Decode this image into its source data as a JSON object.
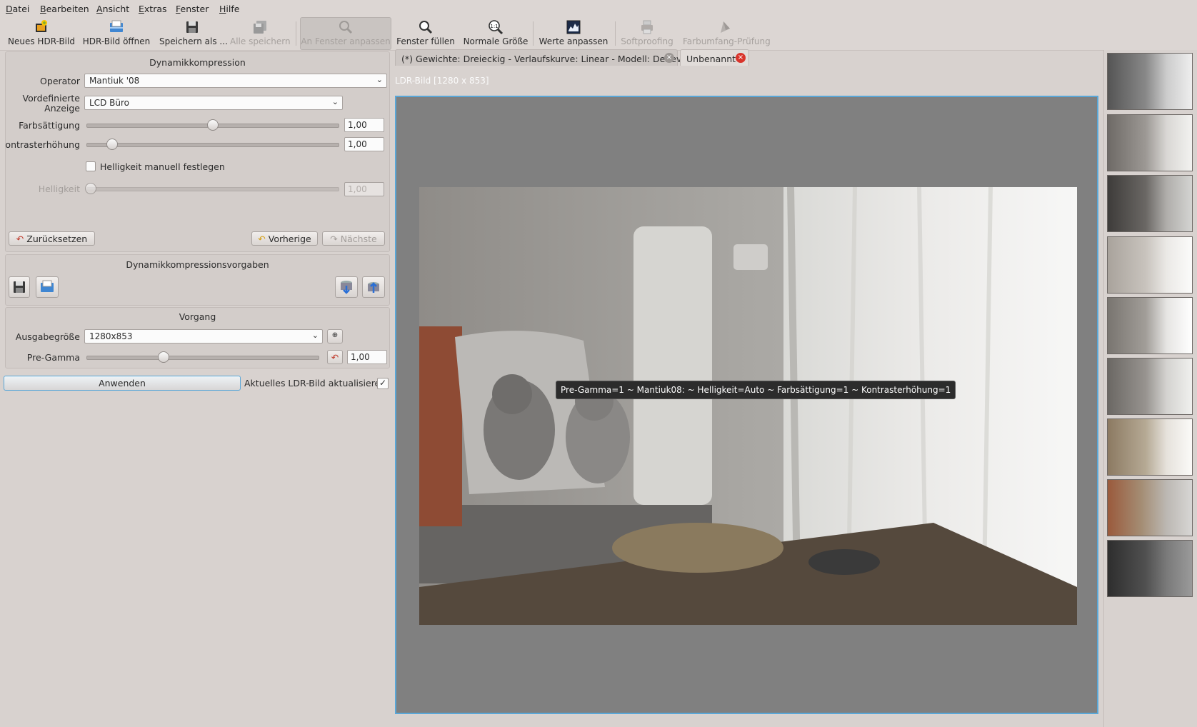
{
  "menu": {
    "items": [
      {
        "pre": "",
        "u": "D",
        "post": "atei"
      },
      {
        "pre": "",
        "u": "B",
        "post": "earbeiten"
      },
      {
        "pre": "",
        "u": "A",
        "post": "nsicht"
      },
      {
        "pre": "",
        "u": "E",
        "post": "xtras"
      },
      {
        "pre": "",
        "u": "F",
        "post": "enster"
      },
      {
        "pre": "",
        "u": "H",
        "post": "ilfe"
      }
    ]
  },
  "toolbar": {
    "new_hdr": "Neues HDR-Bild",
    "open_hdr": "HDR-Bild öffnen",
    "save_as": "Speichern als ...",
    "save_all": "Alle speichern",
    "fit_window": "An Fenster anpassen",
    "fill_window": "Fenster füllen",
    "normal_size": "Normale Größe",
    "zoom_11": "1:1",
    "adjust_levels": "Werte anpassen",
    "softproofing": "Softproofing",
    "gamut_check": "Farbumfang-Prüfung"
  },
  "tonemap": {
    "title": "Dynamikkompression",
    "operator_label": "Operator",
    "operator_value": "Mantiuk '08",
    "display_label_1": "Vordefinierte",
    "display_label_2": "Anzeige",
    "display_value": "LCD Büro",
    "saturation_label": "Farbsättigung",
    "saturation_value": "1,00",
    "saturation_level": 0.5,
    "contrast_label": "Kontrasterhöhung",
    "contrast_value": "1,00",
    "contrast_level": 0.1,
    "manual_brightness_label": "Helligkeit manuell festlegen",
    "brightness_label": "Helligkeit",
    "brightness_value": "1,00",
    "reset": "Zurücksetzen",
    "previous": "Vorherige",
    "next": "Nächste"
  },
  "presets": {
    "title": "Dynamikkompressionsvorgaben"
  },
  "process": {
    "title": "Vorgang",
    "output_size_label": "Ausgabegröße",
    "output_size_value": "1280x853",
    "pregamma_label": "Pre-Gamma",
    "pregamma_value": "1,00",
    "pregamma_level": 0.33,
    "apply": "Anwenden",
    "update_ldr_label": "Aktuelles LDR-Bild aktualisieren",
    "update_ldr_checked": "✓"
  },
  "tabs": [
    {
      "label": "(*) Gewichte: Dreieckig - Verlaufskurve: Linear - Modell: Debevec",
      "close": "×"
    },
    {
      "label": "Unbenannt",
      "close": "×"
    }
  ],
  "viewer": {
    "title": "LDR-Bild [1280 x 853]",
    "tooltip": "Pre-Gamma=1 ~ Mantiuk08: ~ Helligkeit=Auto ~ Farbsättigung=1 ~ Kontrasterhöhung=1"
  },
  "colors": {
    "accent": "#59a7d8",
    "close_red": "#d9342b"
  }
}
